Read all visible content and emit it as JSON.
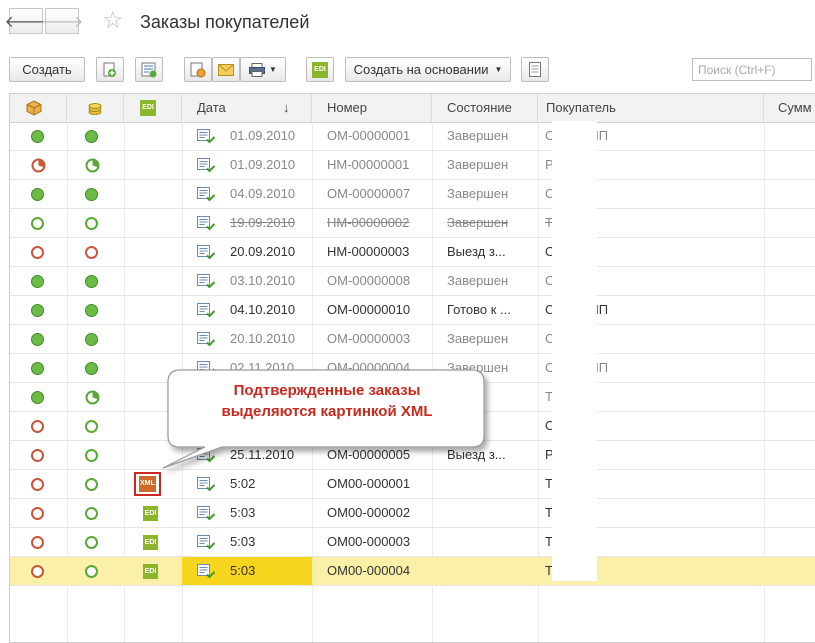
{
  "window": {
    "title": "Заказы покупателей",
    "back_icon": "arrow-left-icon",
    "forward_icon": "arrow-right-icon"
  },
  "toolbar": {
    "create_label": "Создать",
    "create_based_label": "Создать на основании",
    "search_placeholder": "Поиск (Ctrl+F)",
    "edi_label": "EDI"
  },
  "table": {
    "headers": {
      "status1_icon": "box-icon",
      "status2_icon": "coins-icon",
      "edi": "EDI",
      "date": "Дата",
      "sort_indicator": "↓",
      "number": "Номер",
      "state": "Состояние",
      "buyer": "Покупатель",
      "sum": "Сумм"
    },
    "rows": [
      {
        "s1": "green-filled",
        "s2": "green-filled",
        "edi": "none",
        "date": "01.09.2010",
        "number": "ОМ-00000001",
        "state": "Завершен",
        "buyer": "С...нів, ПП",
        "style": "grey"
      },
      {
        "s1": "red-pie",
        "s2": "green-pie",
        "edi": "none",
        "date": "01.09.2010",
        "number": "НМ-00000001",
        "state": "Завершен",
        "buyer": "Р... В",
        "style": "grey"
      },
      {
        "s1": "green-filled",
        "s2": "green-filled",
        "edi": "none",
        "date": "04.09.2010",
        "number": "ОМ-00000007",
        "state": "Завершен",
        "buyer": "О... П",
        "style": "grey"
      },
      {
        "s1": "green-outline",
        "s2": "green-outline",
        "edi": "none",
        "date": "19.09.2010",
        "number": "НМ-00000002",
        "state": "Завершен",
        "buyer": "Т... Д",
        "style": "strike"
      },
      {
        "s1": "red-outline",
        "s2": "red-outline",
        "edi": "none",
        "date": "20.09.2010",
        "number": "НМ-00000003",
        "state": "Выезд з...",
        "buyer": "О... П",
        "style": "dark"
      },
      {
        "s1": "green-filled",
        "s2": "green-filled",
        "edi": "none",
        "date": "03.10.2010",
        "number": "ОМ-00000008",
        "state": "Завершен",
        "buyer": "О... П",
        "style": "grey"
      },
      {
        "s1": "green-filled",
        "s2": "green-filled",
        "edi": "none",
        "date": "04.10.2010",
        "number": "ОМ-00000010",
        "state": "Готово к ...",
        "buyer": "С...нів, ПП",
        "style": "dark"
      },
      {
        "s1": "green-filled",
        "s2": "green-filled",
        "edi": "none",
        "date": "20.10.2010",
        "number": "ОМ-00000003",
        "state": "Завершен",
        "buyer": "О... П",
        "style": "grey"
      },
      {
        "s1": "green-filled",
        "s2": "green-filled",
        "edi": "none",
        "date": "02.11.2010",
        "number": "ОМ-00000004",
        "state": "Завершен",
        "buyer": "С...нів, ПП",
        "style": "grey"
      },
      {
        "s1": "green-filled",
        "s2": "green-pie",
        "edi": "none",
        "date": "",
        "number": "",
        "state": "",
        "buyer": "Т... П",
        "style": "grey"
      },
      {
        "s1": "red-outline",
        "s2": "green-outline",
        "edi": "none",
        "date": "",
        "number": "",
        "state": "...н...",
        "buyer": "О... П",
        "style": "dark"
      },
      {
        "s1": "red-outline",
        "s2": "green-outline",
        "edi": "none",
        "date": "25.11.2010",
        "number": "ОМ-00000005",
        "state": "Выезд з...",
        "buyer": "Р... В",
        "style": "dark"
      },
      {
        "s1": "red-outline",
        "s2": "green-outline",
        "edi": "xml",
        "date": "5:02",
        "number": "ОМ00-000001",
        "state": "",
        "buyer": "Т... П",
        "style": "dark"
      },
      {
        "s1": "red-outline",
        "s2": "green-outline",
        "edi": "edi",
        "date": "5:03",
        "number": "ОМ00-000002",
        "state": "",
        "buyer": "Т... П",
        "style": "dark"
      },
      {
        "s1": "red-outline",
        "s2": "green-outline",
        "edi": "edi",
        "date": "5:03",
        "number": "ОМ00-000003",
        "state": "",
        "buyer": "Т... П",
        "style": "dark"
      },
      {
        "s1": "red-outline",
        "s2": "green-outline",
        "edi": "edi",
        "date": "5:03",
        "number": "ОМ00-000004",
        "state": "",
        "buyer": "Т... П",
        "style": "dark",
        "selected": true
      }
    ]
  },
  "callout": {
    "line1": "Подтвержденные заказы",
    "line2": "выделяются картинкой XML"
  },
  "colors": {
    "accent_red": "#c8281e",
    "edi_green": "#8bb52b",
    "selected_row": "#fbf0a8",
    "selected_date": "#f6d51f"
  }
}
